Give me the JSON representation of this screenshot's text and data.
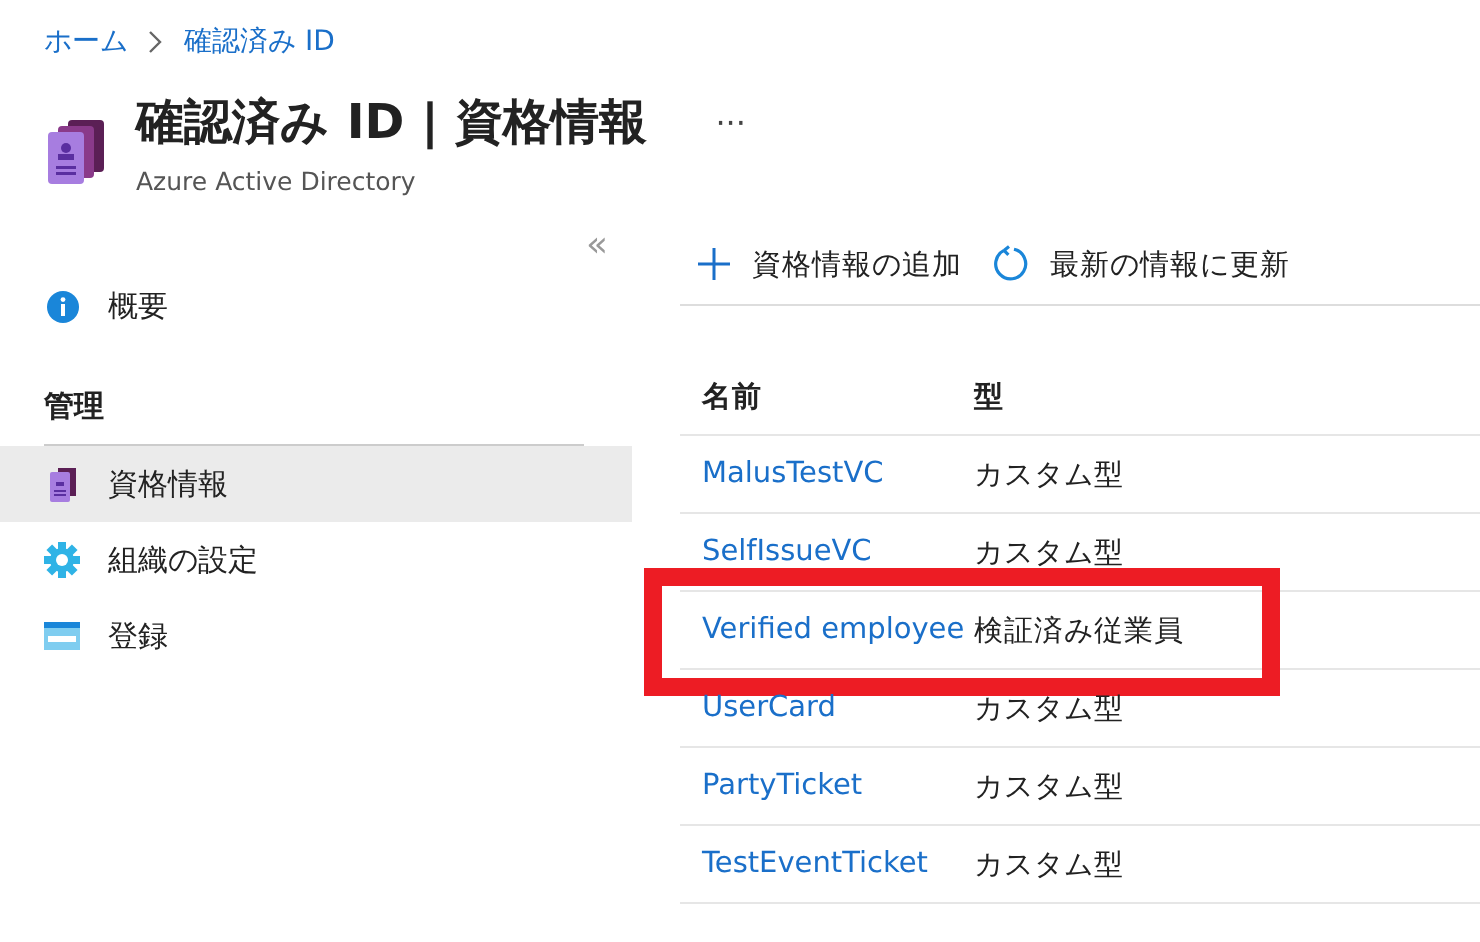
{
  "breadcrumb": [
    {
      "label": "ホーム"
    },
    {
      "label": "確認済み ID"
    }
  ],
  "page": {
    "title": "確認済み ID | 資格情報",
    "subtitle": "Azure Active Directory",
    "more": "···"
  },
  "sidebar": {
    "collapse": "«",
    "items": [
      {
        "kind": "item",
        "label": "概要",
        "selected": false
      },
      {
        "kind": "heading",
        "label": "管理"
      },
      {
        "kind": "item",
        "label": "資格情報",
        "selected": true
      },
      {
        "kind": "item",
        "label": "組織の設定",
        "selected": false
      },
      {
        "kind": "item",
        "label": "登録",
        "selected": false
      }
    ]
  },
  "toolbar": [
    {
      "label": "資格情報の追加"
    },
    {
      "label": "最新の情報に更新"
    }
  ],
  "table": {
    "columns": [
      "名前",
      "型"
    ],
    "rows": [
      {
        "name": "MalusTestVC",
        "type": "カスタム型",
        "highlighted": false
      },
      {
        "name": "SelfIssueVC",
        "type": "カスタム型",
        "highlighted": false
      },
      {
        "name": "Verified employee",
        "type": "検証済み従業員",
        "highlighted": true
      },
      {
        "name": "UserCard",
        "type": "カスタム型",
        "highlighted": false
      },
      {
        "name": "PartyTicket",
        "type": "カスタム型",
        "highlighted": false
      },
      {
        "name": "TestEventTicket",
        "type": "カスタム型",
        "highlighted": false
      }
    ]
  }
}
